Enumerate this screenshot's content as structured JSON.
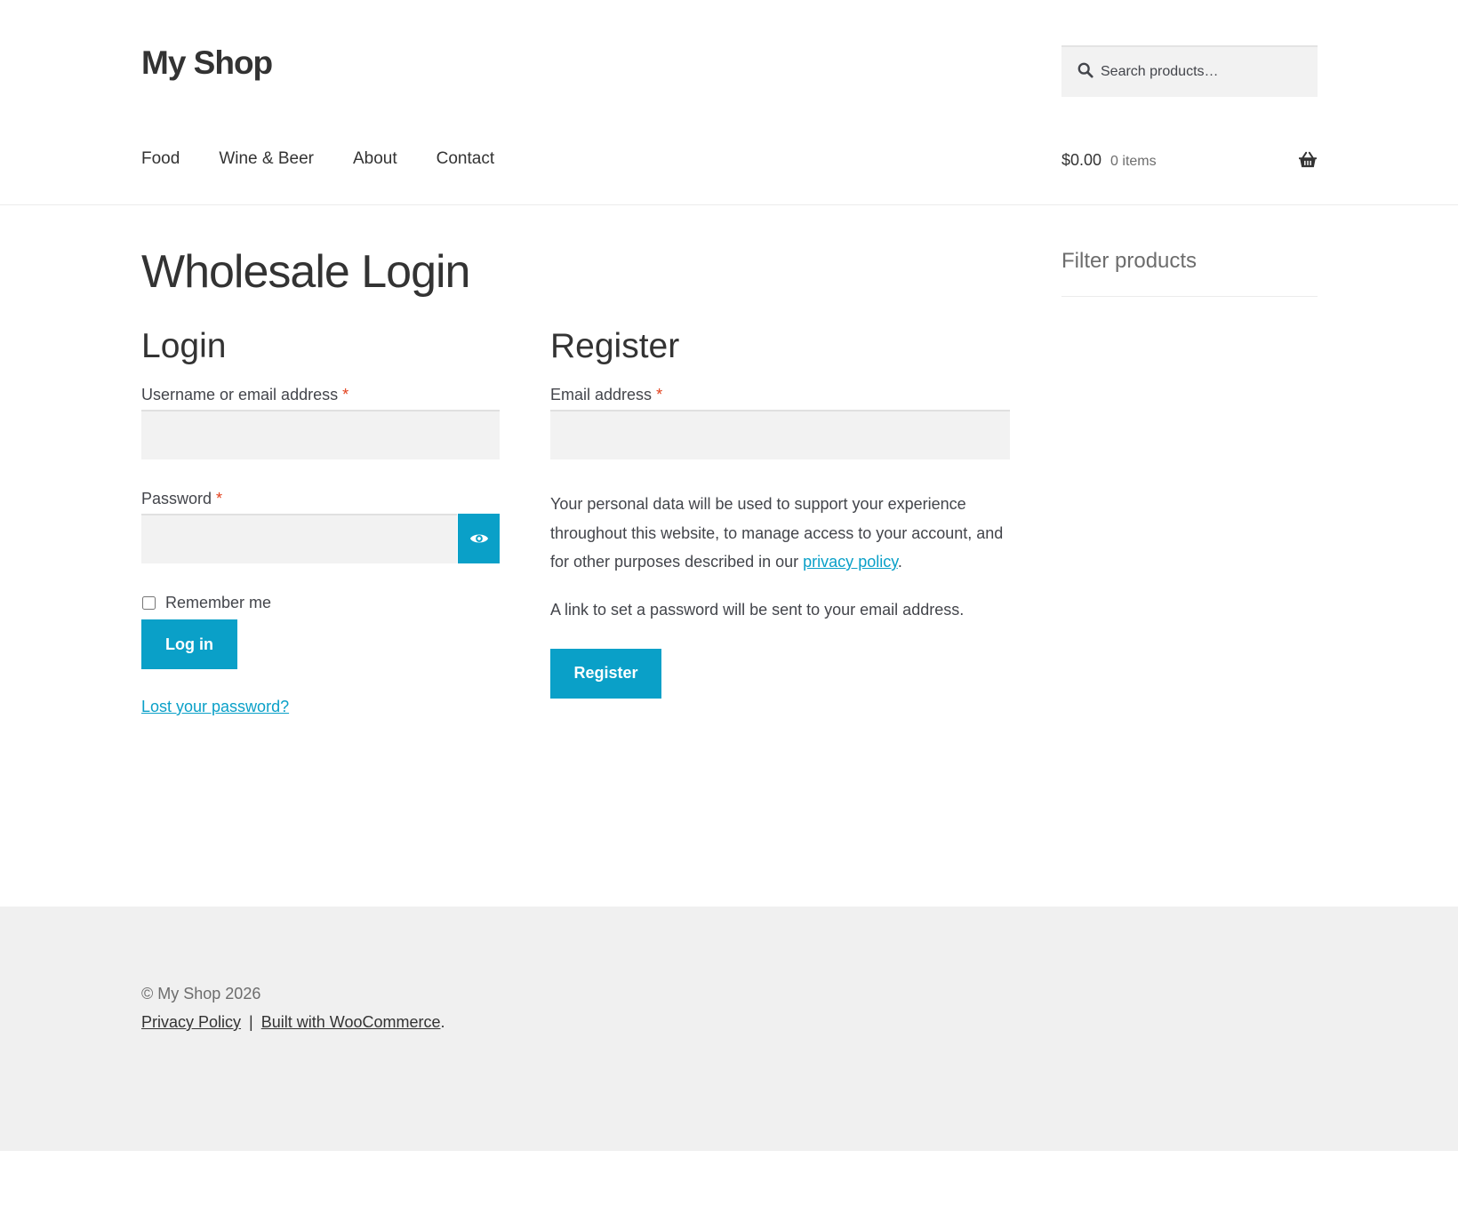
{
  "header": {
    "site_title": "My Shop",
    "search_placeholder": "Search products…",
    "nav": [
      "Food",
      "Wine & Beer",
      "About",
      "Contact"
    ],
    "cart_amount": "$0.00",
    "cart_count": "0 items"
  },
  "page": {
    "title": "Wholesale Login"
  },
  "login": {
    "heading": "Login",
    "username_label": "Username or email address",
    "password_label": "Password",
    "required_mark": "*",
    "remember_label": "Remember me",
    "button_label": "Log in",
    "lost_password": "Lost your password?"
  },
  "register": {
    "heading": "Register",
    "email_label": "Email address",
    "required_mark": "*",
    "privacy_text_before": "Your personal data will be used to support your experience throughout this website, to manage access to your account, and for other purposes described in our ",
    "privacy_link": "privacy policy",
    "privacy_text_after": ".",
    "note": "A link to set a password will be sent to your email address.",
    "button_label": "Register"
  },
  "sidebar": {
    "title": "Filter products"
  },
  "footer": {
    "copyright": "© My Shop 2026",
    "privacy_link": "Privacy Policy",
    "separator": "|",
    "built_link": "Built with WooCommerce",
    "built_suffix": "."
  },
  "colors": {
    "accent": "#0aa0c8",
    "required": "#e2401c",
    "text": "#43454b",
    "footer_bg": "#f0f0f0"
  },
  "icons": [
    "search-icon",
    "basket-icon",
    "eye-icon"
  ]
}
